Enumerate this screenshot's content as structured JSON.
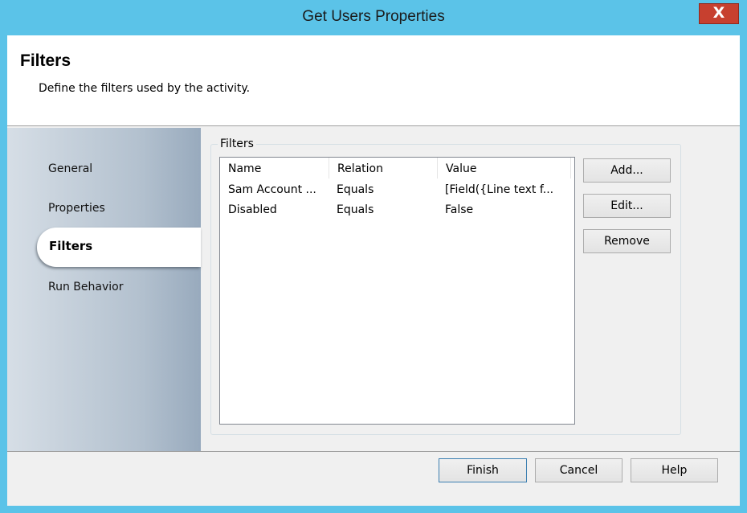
{
  "window": {
    "title": "Get Users Properties",
    "close_glyph": "X"
  },
  "header": {
    "title": "Filters",
    "description": "Define the filters used by the activity."
  },
  "sidebar": {
    "items": [
      {
        "label": "General"
      },
      {
        "label": "Properties"
      },
      {
        "label": "Filters",
        "selected": true
      },
      {
        "label": "Run Behavior"
      }
    ]
  },
  "filters": {
    "group_label": "Filters",
    "columns": [
      "Name",
      "Relation",
      "Value"
    ],
    "rows": [
      {
        "name": "Sam Account ...",
        "relation": "Equals",
        "value": "[Field({Line text f..."
      },
      {
        "name": "Disabled",
        "relation": "Equals",
        "value": "False"
      }
    ],
    "buttons": {
      "add": "Add...",
      "edit": "Edit...",
      "remove": "Remove"
    }
  },
  "footer": {
    "finish": "Finish",
    "cancel": "Cancel",
    "help": "Help"
  },
  "colors": {
    "titlebar": "#5bc3e8",
    "close": "#c7402f",
    "default_border": "#3c7fb1"
  }
}
